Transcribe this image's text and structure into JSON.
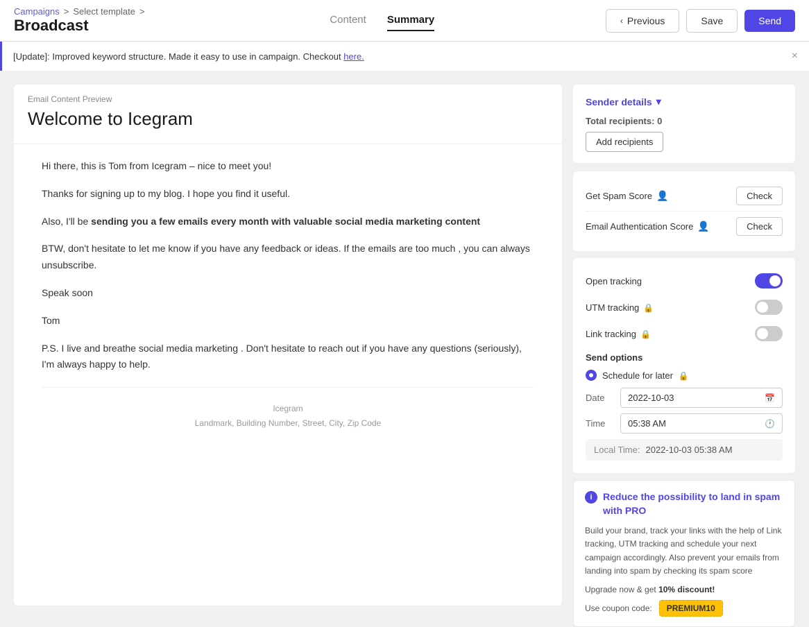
{
  "breadcrumb": {
    "campaigns_label": "Campaigns",
    "select_template_label": "Select template",
    "sep": ">"
  },
  "header": {
    "page_title": "Broadcast",
    "tabs": [
      {
        "id": "content",
        "label": "Content",
        "active": false
      },
      {
        "id": "summary",
        "label": "Summary",
        "active": true
      }
    ],
    "previous_button": "Previous",
    "save_button": "Save",
    "send_button": "Send"
  },
  "notification": {
    "text": "[Update]: Improved keyword structure. Made it easy to use in campaign. Checkout ",
    "link_text": "here.",
    "close_label": "×"
  },
  "preview": {
    "label": "Email Content Preview",
    "subject": "Welcome to Icegram",
    "body_paragraphs": [
      "Hi there, this is Tom from Icegram – nice to meet you!",
      "Thanks for signing up to my blog. I hope you find it useful.",
      "Also, I'll be sending you a few emails every month with valuable social media marketing content",
      "BTW, don't hesitate to let me know if you have any feedback or ideas. If the emails are too much , you can always unsubscribe.",
      "Speak soon",
      "Tom",
      "P.S. I live and breathe social media marketing . Don't hesitate to reach out if you have any questions (seriously), I'm always happy to help."
    ],
    "bold_text": "sending you a few emails every month with valuable social media marketing content",
    "footer_company": "Icegram",
    "footer_address": "Landmark, Building Number, Street, City, Zip Code"
  },
  "sidebar": {
    "sender_details_label": "Sender details",
    "total_recipients_label": "Total recipients:",
    "total_recipients_count": "0",
    "add_recipients_label": "Add recipients",
    "get_spam_score_label": "Get Spam Score",
    "check_spam_label": "Check",
    "email_auth_score_label": "Email Authentication Score",
    "check_auth_label": "Check",
    "tracking": {
      "open_tracking_label": "Open tracking",
      "open_tracking_on": true,
      "utm_tracking_label": "UTM tracking",
      "utm_tracking_on": false,
      "link_tracking_label": "Link tracking",
      "link_tracking_on": false
    },
    "send_options_label": "Send options",
    "schedule_later_label": "Schedule for later",
    "date_label": "Date",
    "date_value": "2022-10-03",
    "time_label": "Time",
    "time_value": "05:38 AM",
    "local_time_label": "Local Time:",
    "local_time_value": "2022-10-03 05:38 AM",
    "pro_banner": {
      "title": "Reduce the possibility to land in spam with PRO",
      "description": "Build your brand, track your links with the help of Link tracking, UTM tracking and schedule your next campaign accordingly. Also prevent your emails from landing into spam by checking its spam score",
      "upgrade_text": "Upgrade now & get ",
      "discount": "10% discount!",
      "coupon_label": "Use coupon code:",
      "coupon_code": "PREMIUM10"
    }
  }
}
